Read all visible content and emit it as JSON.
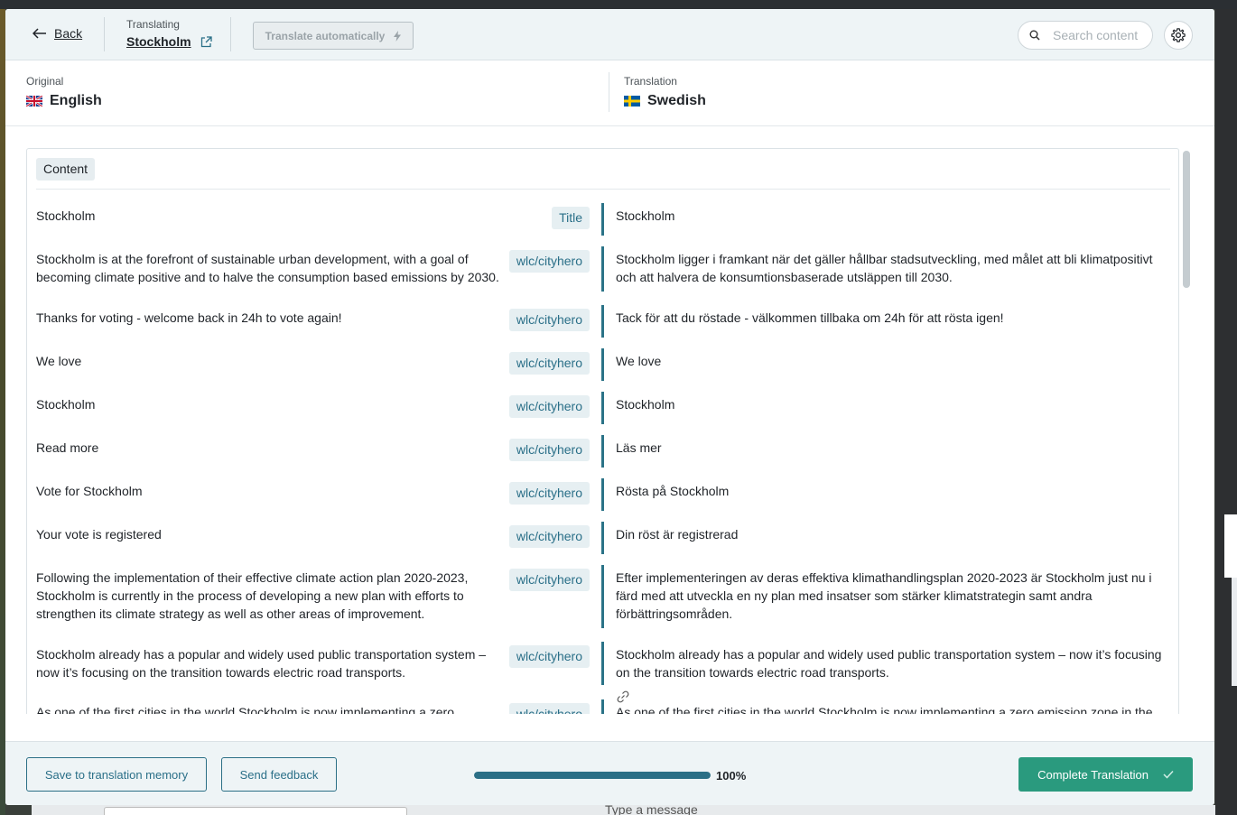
{
  "header": {
    "back_label": "Back",
    "translating_label": "Translating",
    "page_name": "Stockholm",
    "auto_translate_label": "Translate automatically",
    "search_placeholder": "Search content"
  },
  "languages": {
    "original_label": "Original",
    "original_name": "English",
    "translation_label": "Translation",
    "translation_name": "Swedish"
  },
  "panel": {
    "section_label": "Content",
    "rows": [
      {
        "original": "Stockholm",
        "tag": "Title",
        "translation": "Stockholm"
      },
      {
        "original": "Stockholm is at the forefront of sustainable urban development, with a goal of becoming climate positive and to halve the consumption based emissions by 2030.",
        "tag": "wlc/cityhero",
        "translation": "Stockholm ligger i framkant när det gäller hållbar stadsutveckling, med målet att bli klimatpositivt och att halvera de konsumtionsbaserade utsläppen till 2030."
      },
      {
        "original": "Thanks for voting - welcome back in 24h to vote again!",
        "tag": "wlc/cityhero",
        "translation": "Tack för att du röstade - välkommen tillbaka om 24h för att rösta igen!"
      },
      {
        "original": "We love",
        "tag": "wlc/cityhero",
        "translation": "We love"
      },
      {
        "original": "Stockholm",
        "tag": "wlc/cityhero",
        "translation": "Stockholm"
      },
      {
        "original": "Read more",
        "tag": "wlc/cityhero",
        "translation": "Läs mer"
      },
      {
        "original": "Vote for Stockholm",
        "tag": "wlc/cityhero",
        "translation": "Rösta på Stockholm"
      },
      {
        "original": "Your vote is registered",
        "tag": "wlc/cityhero",
        "translation": "Din röst är registrerad"
      },
      {
        "original": "Following the implementation of their effective climate action plan 2020-2023, Stockholm is currently in the process of developing a new plan with efforts to strengthen its climate strategy as well as other areas of improvement.",
        "tag": "wlc/cityhero",
        "translation": "Efter implementeringen av deras effektiva klimathandlingsplan 2020-2023 är Stockholm just nu i färd med att utveckla en ny plan med insatser som stärker klimatstrategin samt andra förbättringsområden."
      },
      {
        "original": "Stockholm already has a popular and widely used public transportation system – now it’s focusing on the transition towards electric road transports.",
        "tag": "wlc/cityhero",
        "translation": "Stockholm already has a popular and widely used public transportation system – now it’s focusing on the transition towards electric road transports."
      },
      {
        "original": "As one of the first cities in the world Stockholm is now implementing a zero",
        "tag": "wlc/cityhero",
        "translation": "As one of the first cities in the world Stockholm is now implementing a zero emission zone in the"
      }
    ]
  },
  "footer": {
    "save_memory_label": "Save to translation memory",
    "feedback_label": "Send feedback",
    "progress_value": 100,
    "progress_text": "100%",
    "complete_label": "Complete Translation"
  },
  "background": {
    "message_placeholder": "Type a message"
  },
  "colors": {
    "accent": "#2b6f86",
    "complete": "#2a9a7e",
    "header_bg": "#eef4f6"
  }
}
